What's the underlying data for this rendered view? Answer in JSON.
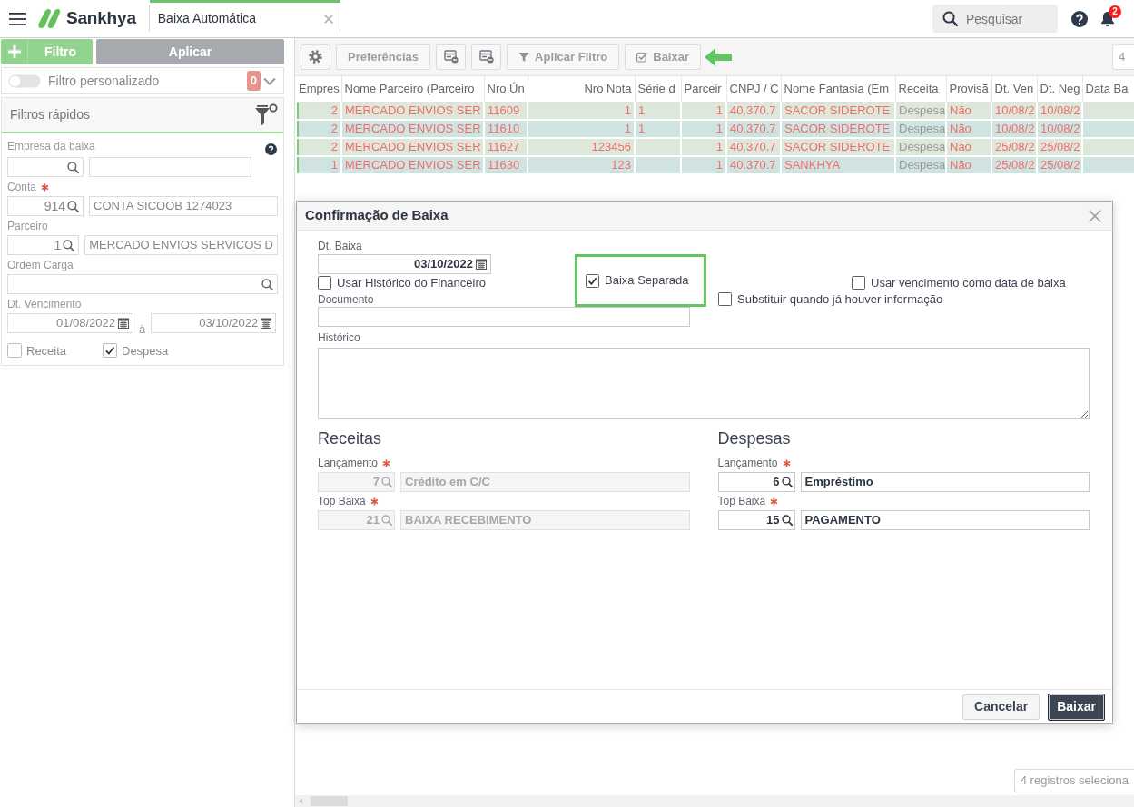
{
  "header": {
    "brand": "Sankhya",
    "tabs": [
      {
        "label": "Baixa Automática",
        "selected": true
      }
    ],
    "search": {
      "placeholder": "Pesquisar"
    },
    "notification_count": "2"
  },
  "filter_panel": {
    "add_button": "Filtro",
    "apply_button": "Aplicar",
    "custom_filter": {
      "label": "Filtro personalizado",
      "on": false,
      "count": "0"
    },
    "quick_filters": {
      "title": "Filtros rápidos",
      "fields": [
        {
          "kind": "lookup",
          "label": "Empresa da baixa",
          "help": true
        },
        {
          "kind": "lookup",
          "label": "Conta",
          "required": true,
          "code": "914",
          "description": "CONTA SICOOB 1274023"
        },
        {
          "kind": "lookup",
          "label": "Parceiro",
          "code": "1",
          "description": "MERCADO ENVIOS SERVICOS D"
        },
        {
          "kind": "search",
          "label": "Ordem Carga"
        },
        {
          "kind": "daterange",
          "label": "Dt. Vencimento",
          "from": "01/08/2022",
          "separator": "à",
          "to": "03/10/2022"
        },
        {
          "kind": "checks",
          "options": [
            {
              "label": "Receita",
              "checked": false
            },
            {
              "label": "Despesa",
              "checked": true
            }
          ]
        }
      ]
    }
  },
  "toolbar": {
    "preferences": "Preferências",
    "apply_filter": "Aplicar Filtro",
    "settle": {
      "label": "Baixar",
      "highlighted": true
    },
    "count_field": "4"
  },
  "table": {
    "columns": [
      "Empres",
      "Nome Parceiro (Parceiro",
      "Nro Ún",
      "Nro Nota",
      "Série d",
      "Parceir",
      "CNPJ / C",
      "Nome Fantasia (Em",
      "Receita",
      "Provisã",
      "Dt. Ven",
      "Dt. Neg",
      "Data Ba"
    ],
    "rows": [
      {
        "selected": true,
        "cells": [
          "2",
          "MERCADO ENVIOS SER",
          "11609",
          "1",
          "1",
          "1",
          "40.370.7",
          "SACOR SIDEROTE",
          "Despesa",
          "Não",
          "10/08/2",
          "10/08/2"
        ]
      },
      {
        "selected": true,
        "cells": [
          "2",
          "MERCADO ENVIOS SER",
          "11610",
          "1",
          "1",
          "1",
          "40.370.7",
          "SACOR SIDEROTE",
          "Despesa",
          "Não",
          "10/08/2",
          "10/08/2"
        ]
      },
      {
        "selected": true,
        "cells": [
          "2",
          "MERCADO ENVIOS SER",
          "11627",
          "123456",
          null,
          "1",
          "40.370.7",
          "SACOR SIDEROTE",
          "Despesa",
          "Não",
          "25/08/2",
          "25/08/2"
        ]
      },
      {
        "selected": true,
        "cells": [
          "1",
          "MERCADO ENVIOS SER",
          "11630",
          "123",
          null,
          "1",
          "40.370.7",
          "SANKHYA",
          "Despesa",
          "Não",
          "25/08/2",
          "25/08/2"
        ]
      }
    ]
  },
  "dialog": {
    "title": "Confirmação de Baixa",
    "date": {
      "label": "Dt. Baixa",
      "value": "03/10/2022"
    },
    "options": [
      {
        "label": "Usar Histórico do Financeiro",
        "checked": false
      },
      {
        "label": "Baixa Separada",
        "checked": true,
        "highlighted": true
      },
      {
        "label": "Usar vencimento como data de baixa",
        "checked": false
      },
      {
        "label": "Substituir quando já houver informação",
        "checked": false
      }
    ],
    "document": {
      "label": "Documento"
    },
    "history": {
      "label": "Histórico"
    },
    "sections": [
      {
        "title": "Receitas",
        "disabled": true,
        "fields": [
          {
            "label": "Lançamento",
            "required": true,
            "code": "7",
            "description": "Crédito em C/C"
          },
          {
            "label": "Top Baixa",
            "required": true,
            "code": "21",
            "description": "BAIXA RECEBIMENTO"
          }
        ]
      },
      {
        "title": "Despesas",
        "disabled": false,
        "fields": [
          {
            "label": "Lançamento",
            "required": true,
            "code": "6",
            "description": "Empréstimo"
          },
          {
            "label": "Top Baixa",
            "required": true,
            "code": "15",
            "description": "PAGAMENTO"
          }
        ]
      }
    ],
    "buttons": [
      {
        "label": "Cancelar",
        "primary": false
      },
      {
        "label": "Baixar",
        "primary": true
      }
    ]
  },
  "status_bar": {
    "selection": "4 registros seleciona"
  }
}
